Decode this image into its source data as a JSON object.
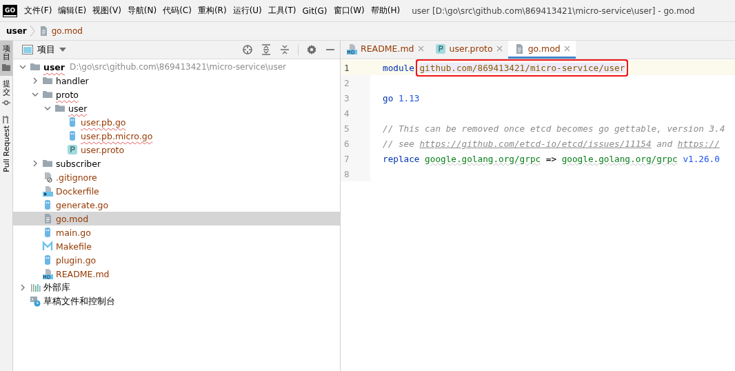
{
  "menu_bar": {
    "logo": "GO",
    "items": [
      "文件(F)",
      "编辑(E)",
      "视图(V)",
      "导航(N)",
      "代码(C)",
      "重构(R)",
      "运行(U)",
      "工具(T)",
      "Git(G)",
      "窗口(W)",
      "帮助(H)"
    ],
    "title": "user [D:\\go\\src\\github.com\\869413421\\micro-service\\user] - go.mod"
  },
  "breadcrumb": [
    {
      "label": "user",
      "kind": "project"
    },
    {
      "label": "go.mod",
      "kind": "file"
    }
  ],
  "left_strip": [
    {
      "label": "项目",
      "kind": "folder",
      "selected": true
    },
    {
      "label": "提交",
      "kind": "commit",
      "selected": false
    },
    {
      "label": "Pull Request",
      "kind": "pr",
      "selected": false
    }
  ],
  "project_panel": {
    "title": "项目",
    "tree": [
      {
        "name": "user",
        "path": "D:\\go\\src\\github.com\\869413421\\micro-service\\user",
        "kind": "folder",
        "root": true,
        "expanded": true,
        "misspelled": true,
        "untracked": false,
        "selected": false,
        "children": [
          {
            "name": "handler",
            "kind": "folder",
            "expanded": false,
            "misspelled": false,
            "untracked": false,
            "selected": false
          },
          {
            "name": "proto",
            "kind": "folder",
            "expanded": true,
            "misspelled": true,
            "untracked": false,
            "selected": false,
            "children": [
              {
                "name": "user",
                "kind": "folder",
                "expanded": true,
                "misspelled": true,
                "untracked": false,
                "selected": false,
                "children": [
                  {
                    "name": "user.pb.go",
                    "kind": "go",
                    "misspelled": true,
                    "untracked": true,
                    "selected": false
                  },
                  {
                    "name": "user.pb.micro.go",
                    "kind": "go",
                    "misspelled": true,
                    "untracked": true,
                    "selected": false
                  },
                  {
                    "name": "user.proto",
                    "kind": "proto",
                    "misspelled": false,
                    "untracked": true,
                    "selected": false
                  }
                ]
              }
            ]
          },
          {
            "name": "subscriber",
            "kind": "folder",
            "expanded": false,
            "misspelled": false,
            "untracked": false,
            "selected": false
          },
          {
            "name": ".gitignore",
            "kind": "ignore",
            "misspelled": false,
            "untracked": true,
            "selected": false
          },
          {
            "name": "Dockerfile",
            "kind": "docker",
            "misspelled": false,
            "untracked": true,
            "selected": false
          },
          {
            "name": "generate.go",
            "kind": "go",
            "misspelled": false,
            "untracked": true,
            "selected": false
          },
          {
            "name": "go.mod",
            "kind": "text",
            "misspelled": false,
            "untracked": true,
            "selected": true
          },
          {
            "name": "main.go",
            "kind": "go",
            "misspelled": false,
            "untracked": true,
            "selected": false
          },
          {
            "name": "Makefile",
            "kind": "make",
            "misspelled": false,
            "untracked": true,
            "selected": false
          },
          {
            "name": "plugin.go",
            "kind": "go",
            "misspelled": false,
            "untracked": true,
            "selected": false
          },
          {
            "name": "README.md",
            "kind": "md",
            "misspelled": false,
            "untracked": true,
            "selected": false
          }
        ]
      },
      {
        "name": "外部库",
        "kind": "library",
        "root": false,
        "expanded": false,
        "misspelled": false,
        "untracked": false,
        "selected": false
      },
      {
        "name": "草稿文件和控制台",
        "kind": "scratch",
        "misspelled": false,
        "untracked": false,
        "selected": false
      }
    ]
  },
  "editor": {
    "tabs": [
      {
        "label": "README.md",
        "kind": "md",
        "selected": false
      },
      {
        "label": "user.proto",
        "kind": "proto",
        "selected": false
      },
      {
        "label": "go.mod",
        "kind": "text",
        "selected": true
      }
    ],
    "lines": [
      {
        "number": "1",
        "current": true,
        "tokens": [
          {
            "text": "module",
            "kind": "keyword"
          },
          {
            "text": "github.com/869413421/micro-service/user",
            "kind": "path",
            "annotated": true
          }
        ]
      },
      {
        "number": "2",
        "current": false
      },
      {
        "number": "3",
        "current": false,
        "tokens": [
          {
            "text": "go",
            "kind": "keyword"
          },
          {
            "text": "1.13",
            "kind": "number"
          }
        ]
      },
      {
        "number": "4",
        "current": false
      },
      {
        "number": "5",
        "current": false,
        "tokens": [
          {
            "text": "// This can be removed once etcd becomes go gettable, version 3.4",
            "kind": "comment"
          }
        ]
      },
      {
        "number": "6",
        "current": false,
        "tokens": [
          {
            "text": "// see",
            "kind": "comment"
          },
          {
            "text": "https://github.com/etcd-io/etcd/issues/11154",
            "kind": "link"
          },
          {
            "text": "and",
            "kind": "comment"
          },
          {
            "text": "https://",
            "kind": "link"
          }
        ]
      },
      {
        "number": "7",
        "current": false,
        "tokens": [
          {
            "text": "replace",
            "kind": "keyword"
          },
          {
            "text": "google.golang.org/grpc",
            "kind": "module"
          },
          {
            "text": "=>",
            "kind": "operator"
          },
          {
            "text": "google.golang.org/grpc",
            "kind": "module"
          },
          {
            "text": "v1.26.0",
            "kind": "number"
          }
        ]
      },
      {
        "number": "8",
        "current": false
      }
    ]
  }
}
